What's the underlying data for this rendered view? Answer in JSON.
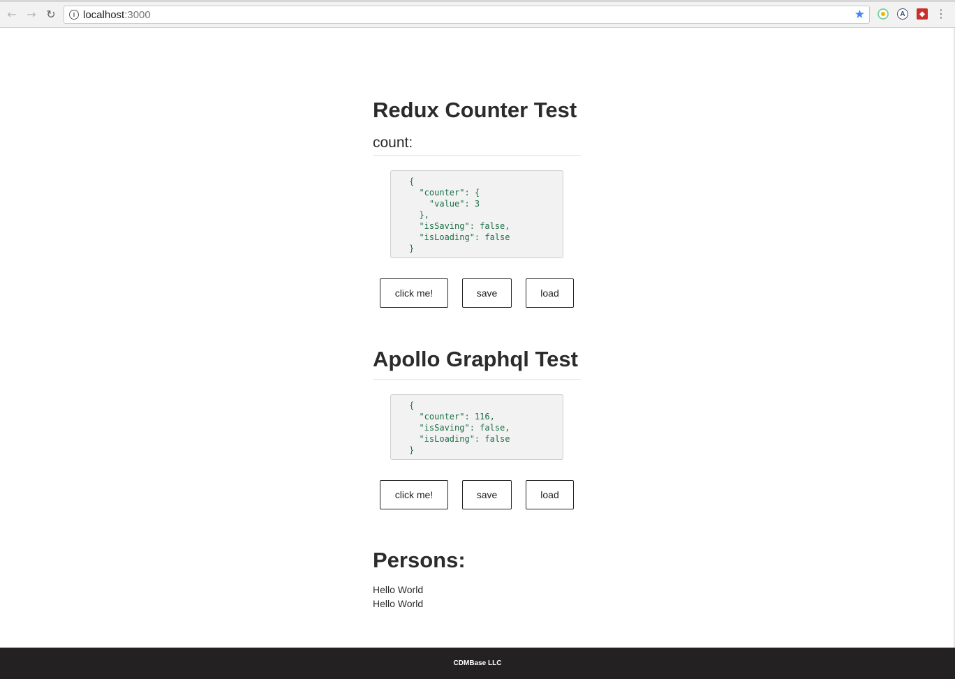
{
  "browser": {
    "url_host": "localhost",
    "url_port": ":3000",
    "icons": {
      "back": "back-arrow-icon",
      "forward": "forward-arrow-icon",
      "reload": "reload-icon",
      "info": "info-icon",
      "bookmark": "star-icon",
      "menu": "kebab-menu-icon"
    },
    "ext2_label": "A",
    "accent": "#4285f4"
  },
  "redux": {
    "title": "Redux Counter Test",
    "count_label": "count:",
    "json_lines": [
      "{",
      "  \"counter\": {",
      "    \"value\": 3",
      "  },",
      "  \"isSaving\": false,",
      "  \"isLoading\": false",
      "}"
    ],
    "buttons": {
      "click": "click me!",
      "save": "save",
      "load": "load"
    }
  },
  "apollo": {
    "title": "Apollo Graphql Test",
    "json_lines": [
      "{",
      "  \"counter\": 116,",
      "  \"isSaving\": false,",
      "  \"isLoading\": false",
      "}"
    ],
    "buttons": {
      "click": "click me!",
      "save": "save",
      "load": "load"
    }
  },
  "persons": {
    "title": "Persons:",
    "items": [
      "Hello World",
      "Hello World"
    ]
  },
  "footer": {
    "text": "CDMBase LLC"
  }
}
